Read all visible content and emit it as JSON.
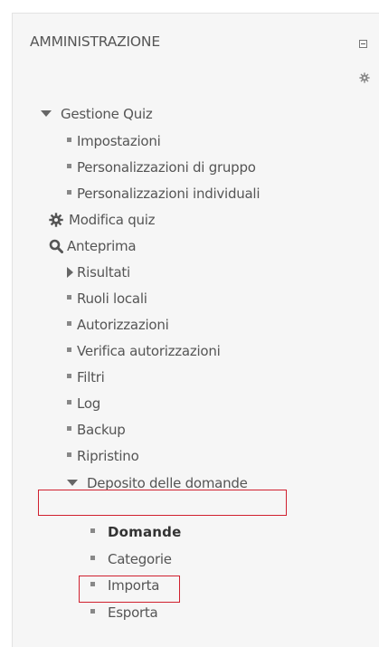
{
  "block": {
    "title": "AMMINISTRAZIONE",
    "colors": {
      "highlight": "#d0202e",
      "text": "#555555",
      "background": "#f6f6f6"
    }
  },
  "tree": {
    "root": "Gestione Quiz",
    "items": [
      {
        "label": "Impostazioni",
        "icon": "bullet"
      },
      {
        "label": "Personalizzazioni di gruppo",
        "icon": "bullet"
      },
      {
        "label": "Personalizzazioni individuali",
        "icon": "bullet"
      },
      {
        "label": "Modifica quiz",
        "icon": "gear-icon"
      },
      {
        "label": "Anteprima",
        "icon": "search-icon"
      },
      {
        "label": "Risultati",
        "icon": "caret-right-icon"
      },
      {
        "label": "Ruoli locali",
        "icon": "bullet"
      },
      {
        "label": "Autorizzazioni",
        "icon": "bullet"
      },
      {
        "label": "Verifica autorizzazioni",
        "icon": "bullet"
      },
      {
        "label": "Filtri",
        "icon": "bullet"
      },
      {
        "label": "Log",
        "icon": "bullet"
      },
      {
        "label": "Backup",
        "icon": "bullet"
      },
      {
        "label": "Ripristino",
        "icon": "bullet"
      },
      {
        "label": "Deposito delle domande",
        "icon": "caret-down-icon"
      }
    ],
    "question_bank": [
      {
        "label": "Domande",
        "icon": "bullet"
      },
      {
        "label": "Categorie",
        "icon": "bullet"
      },
      {
        "label": "Importa",
        "icon": "bullet"
      },
      {
        "label": "Esporta",
        "icon": "bullet"
      }
    ]
  }
}
